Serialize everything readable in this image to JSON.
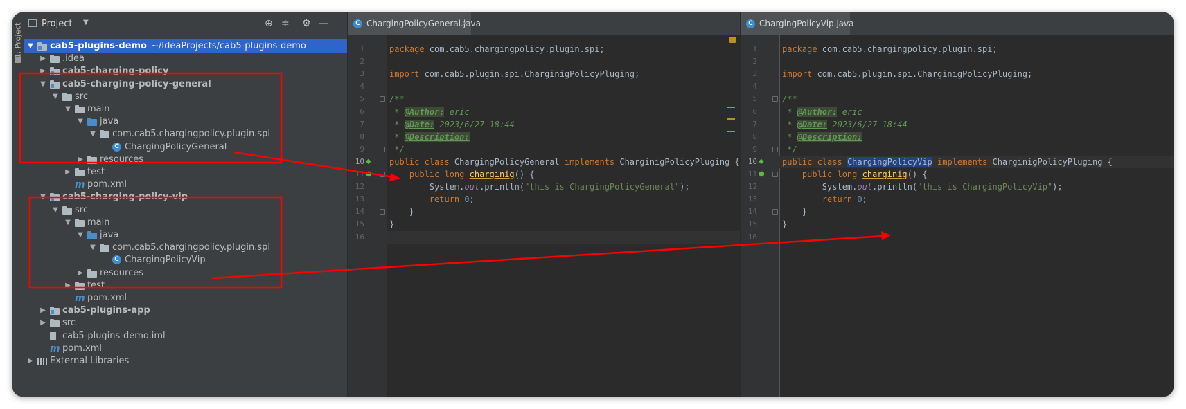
{
  "sidebar": {
    "label": "1: Project"
  },
  "project": {
    "title": "Project",
    "tree": [
      {
        "label": "cab5-plugins-demo",
        "path": "~/IdeaProjects/cab5-plugins-demo"
      },
      {
        "label": ".idea"
      },
      {
        "label": "cab5-charging-policy"
      },
      {
        "label": "cab5-charging-policy-general"
      },
      {
        "label": "src"
      },
      {
        "label": "main"
      },
      {
        "label": "java"
      },
      {
        "label": "com.cab5.chargingpolicy.plugin.spi"
      },
      {
        "label": "ChargingPolicyGeneral"
      },
      {
        "label": "resources"
      },
      {
        "label": "test"
      },
      {
        "label": "pom.xml"
      },
      {
        "label": "cab5-charging-policy-vip"
      },
      {
        "label": "src"
      },
      {
        "label": "main"
      },
      {
        "label": "java"
      },
      {
        "label": "com.cab5.chargingpolicy.plugin.spi"
      },
      {
        "label": "ChargingPolicyVip"
      },
      {
        "label": "resources"
      },
      {
        "label": "test"
      },
      {
        "label": "pom.xml"
      },
      {
        "label": "cab5-plugins-app"
      },
      {
        "label": "src"
      },
      {
        "label": "cab5-plugins-demo.iml"
      },
      {
        "label": "pom.xml"
      },
      {
        "label": "External Libraries"
      }
    ]
  },
  "editor_general": {
    "tab": "ChargingPolicyGeneral.java",
    "lines": [
      {
        "n": "1",
        "parts": [
          {
            "t": "package",
            "c": "kw"
          },
          {
            "t": " com.cab5.chargingpolicy.plugin.spi;"
          }
        ]
      },
      {
        "n": "2",
        "parts": []
      },
      {
        "n": "3",
        "parts": [
          {
            "t": "import",
            "c": "kw"
          },
          {
            "t": " com.cab5.plugin.spi.CharginigPolicyPluging;"
          }
        ]
      },
      {
        "n": "4",
        "parts": []
      },
      {
        "n": "5",
        "parts": [
          {
            "t": "/**",
            "c": "cm"
          }
        ]
      },
      {
        "n": "6",
        "parts": [
          {
            "t": " * ",
            "c": "cm"
          },
          {
            "t": "@Author:",
            "c": "tg"
          },
          {
            "t": " eric",
            "c": "cm"
          }
        ]
      },
      {
        "n": "7",
        "parts": [
          {
            "t": " * ",
            "c": "cm"
          },
          {
            "t": "@Date:",
            "c": "tg"
          },
          {
            "t": " 2023/6/27 18:44",
            "c": "cm"
          }
        ]
      },
      {
        "n": "8",
        "parts": [
          {
            "t": " * ",
            "c": "cm"
          },
          {
            "t": "@Description:",
            "c": "tg"
          }
        ]
      },
      {
        "n": "9",
        "parts": [
          {
            "t": " */",
            "c": "cm"
          }
        ]
      },
      {
        "n": "10",
        "parts": [
          {
            "t": "public class",
            "c": "kw"
          },
          {
            "t": " ChargingPolicyGeneral "
          },
          {
            "t": "implements",
            "c": "kw"
          },
          {
            "t": " CharginigPolicyPluging {"
          }
        ]
      },
      {
        "n": "11",
        "parts": [
          {
            "t": "    "
          },
          {
            "t": "public long",
            "c": "kw"
          },
          {
            "t": " "
          },
          {
            "t": "charginig",
            "c": "fn"
          },
          {
            "t": "() {"
          }
        ]
      },
      {
        "n": "12",
        "parts": [
          {
            "t": "        System."
          },
          {
            "t": "out",
            "c": "sf"
          },
          {
            "t": ".println("
          },
          {
            "t": "\"this is ChargingPolicyGeneral\"",
            "c": "st"
          },
          {
            "t": ");"
          }
        ]
      },
      {
        "n": "13",
        "parts": [
          {
            "t": "        "
          },
          {
            "t": "return",
            "c": "kw"
          },
          {
            "t": " "
          },
          {
            "t": "0",
            "c": "nu"
          },
          {
            "t": ";"
          }
        ]
      },
      {
        "n": "14",
        "parts": [
          {
            "t": "    }"
          }
        ]
      },
      {
        "n": "15",
        "parts": [
          {
            "t": "}"
          }
        ]
      },
      {
        "n": "16",
        "parts": []
      }
    ]
  },
  "editor_vip": {
    "tab": "ChargingPolicyVip.java",
    "lines": [
      {
        "n": "1",
        "parts": [
          {
            "t": "package",
            "c": "kw"
          },
          {
            "t": " com.cab5.chargingpolicy.plugin.spi;"
          }
        ]
      },
      {
        "n": "2",
        "parts": []
      },
      {
        "n": "3",
        "parts": [
          {
            "t": "import",
            "c": "kw"
          },
          {
            "t": " com.cab5.plugin.spi.CharginigPolicyPluging;"
          }
        ]
      },
      {
        "n": "4",
        "parts": []
      },
      {
        "n": "5",
        "parts": [
          {
            "t": "/**",
            "c": "cm"
          }
        ]
      },
      {
        "n": "6",
        "parts": [
          {
            "t": " * ",
            "c": "cm"
          },
          {
            "t": "@Author:",
            "c": "tg"
          },
          {
            "t": " eric",
            "c": "cm"
          }
        ]
      },
      {
        "n": "7",
        "parts": [
          {
            "t": " * ",
            "c": "cm"
          },
          {
            "t": "@Date:",
            "c": "tg"
          },
          {
            "t": " 2023/6/27 18:44",
            "c": "cm"
          }
        ]
      },
      {
        "n": "8",
        "parts": [
          {
            "t": " * ",
            "c": "cm"
          },
          {
            "t": "@Description:",
            "c": "tg"
          }
        ]
      },
      {
        "n": "9",
        "parts": [
          {
            "t": " */",
            "c": "cm"
          }
        ]
      },
      {
        "n": "10",
        "parts": [
          {
            "t": "public class",
            "c": "kw"
          },
          {
            "t": " "
          },
          {
            "t": "ChargingPolicyVip",
            "c": "hl"
          },
          {
            "t": " "
          },
          {
            "t": "implements",
            "c": "kw"
          },
          {
            "t": " CharginigPolicyPluging {"
          }
        ]
      },
      {
        "n": "11",
        "parts": [
          {
            "t": "    "
          },
          {
            "t": "public long",
            "c": "kw"
          },
          {
            "t": " "
          },
          {
            "t": "charginig",
            "c": "fn"
          },
          {
            "t": "() {"
          }
        ]
      },
      {
        "n": "12",
        "parts": [
          {
            "t": "        System."
          },
          {
            "t": "out",
            "c": "sf"
          },
          {
            "t": ".println("
          },
          {
            "t": "\"this is ChargingPolicyVip\"",
            "c": "st"
          },
          {
            "t": ");"
          }
        ]
      },
      {
        "n": "13",
        "parts": [
          {
            "t": "        "
          },
          {
            "t": "return",
            "c": "kw"
          },
          {
            "t": " "
          },
          {
            "t": "0",
            "c": "nu"
          },
          {
            "t": ";"
          }
        ]
      },
      {
        "n": "14",
        "parts": [
          {
            "t": "    }"
          }
        ]
      },
      {
        "n": "15",
        "parts": [
          {
            "t": "}"
          }
        ]
      },
      {
        "n": "16",
        "parts": []
      }
    ]
  },
  "colors": {
    "panel": "#3c3f41",
    "editor": "#2b2b2b",
    "selection": "#2f65ca",
    "keyword": "#cc7832",
    "string": "#6a8759",
    "doc_comment": "#629755",
    "annotation": "#ff0000"
  }
}
